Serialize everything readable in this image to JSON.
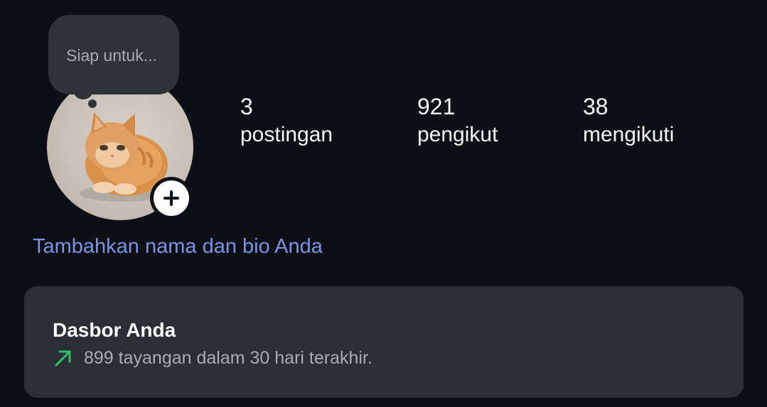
{
  "profile": {
    "note_text": "Siap untuk...",
    "avatar_alt": "orange kitten",
    "add_icon": "plus-icon"
  },
  "stats": {
    "posts_count": "3",
    "posts_label": "postingan",
    "followers_count": "921",
    "followers_label": "pengikut",
    "following_count": "38",
    "following_label": "mengikuti"
  },
  "bio": {
    "link_text": "Tambahkan nama dan bio Anda"
  },
  "dashboard": {
    "title": "Dasbor Anda",
    "subtitle": "899 tayangan dalam 30 hari terakhir.",
    "trend_icon": "arrow-up-right-icon",
    "trend_color": "#2fc06a"
  },
  "colors": {
    "background": "#0c1014",
    "link": "#7b93e6",
    "card": "#2b2f35"
  }
}
